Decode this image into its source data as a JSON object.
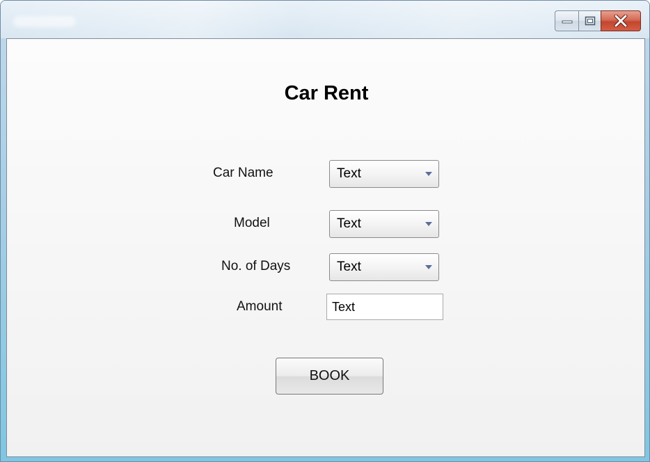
{
  "window": {
    "title": "",
    "controls": {
      "minimize_icon": "minimize-icon",
      "maximize_icon": "maximize-icon",
      "close_icon": "close-icon"
    }
  },
  "form": {
    "heading": "Car Rent",
    "car_name": {
      "label": "Car Name",
      "value": "Text"
    },
    "model": {
      "label": "Model",
      "value": "Text"
    },
    "days": {
      "label": "No. of Days",
      "value": "Text"
    },
    "amount": {
      "label": "Amount",
      "value": "Text"
    },
    "book_label": "BOOK"
  }
}
